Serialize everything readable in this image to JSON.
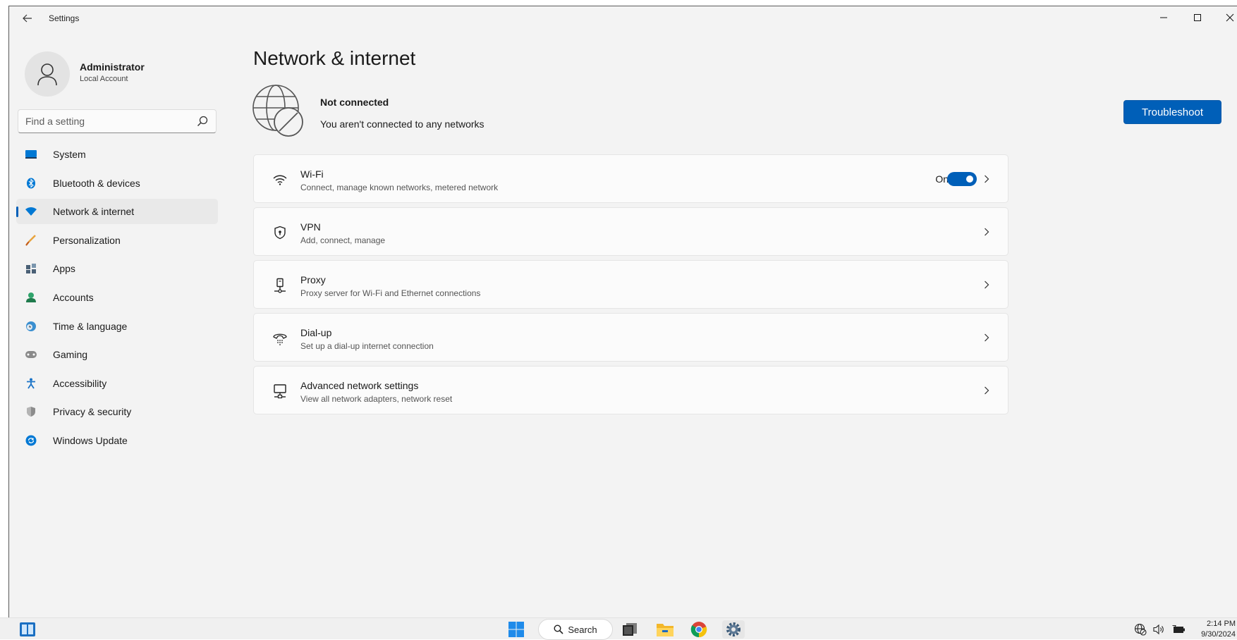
{
  "window": {
    "title": "Settings"
  },
  "user": {
    "name": "Administrator",
    "account_type": "Local Account"
  },
  "search": {
    "placeholder": "Find a setting"
  },
  "sidebar": {
    "items": [
      {
        "label": "System",
        "icon": "system-icon",
        "active": false
      },
      {
        "label": "Bluetooth & devices",
        "icon": "bluetooth-icon",
        "active": false
      },
      {
        "label": "Network & internet",
        "icon": "wifi-icon",
        "active": true
      },
      {
        "label": "Personalization",
        "icon": "brush-icon",
        "active": false
      },
      {
        "label": "Apps",
        "icon": "apps-icon",
        "active": false
      },
      {
        "label": "Accounts",
        "icon": "person-icon",
        "active": false
      },
      {
        "label": "Time & language",
        "icon": "globe-clock-icon",
        "active": false
      },
      {
        "label": "Gaming",
        "icon": "gamepad-icon",
        "active": false
      },
      {
        "label": "Accessibility",
        "icon": "accessibility-icon",
        "active": false
      },
      {
        "label": "Privacy & security",
        "icon": "shield-icon",
        "active": false
      },
      {
        "label": "Windows Update",
        "icon": "update-icon",
        "active": false
      }
    ]
  },
  "main": {
    "title": "Network & internet",
    "status": {
      "title": "Not connected",
      "description": "You aren't connected to any networks",
      "icon": "globe-disconnected-icon"
    },
    "troubleshoot_label": "Troubleshoot",
    "cards": [
      {
        "title": "Wi-Fi",
        "subtitle": "Connect, manage known networks, metered network",
        "icon": "wifi-icon",
        "toggle_label": "On",
        "toggle_on": true
      },
      {
        "title": "VPN",
        "subtitle": "Add, connect, manage",
        "icon": "vpn-shield-icon"
      },
      {
        "title": "Proxy",
        "subtitle": "Proxy server for Wi-Fi and Ethernet connections",
        "icon": "proxy-icon"
      },
      {
        "title": "Dial-up",
        "subtitle": "Set up a dial-up internet connection",
        "icon": "dialup-icon"
      },
      {
        "title": "Advanced network settings",
        "subtitle": "View all network adapters, network reset",
        "icon": "monitor-network-icon"
      }
    ]
  },
  "taskbar": {
    "search_label": "Search",
    "time": "2:14 PM",
    "date": "9/30/2024"
  },
  "colors": {
    "accent": "#005fb8",
    "window_bg": "#f3f3f3",
    "card_bg": "#fbfbfb"
  }
}
